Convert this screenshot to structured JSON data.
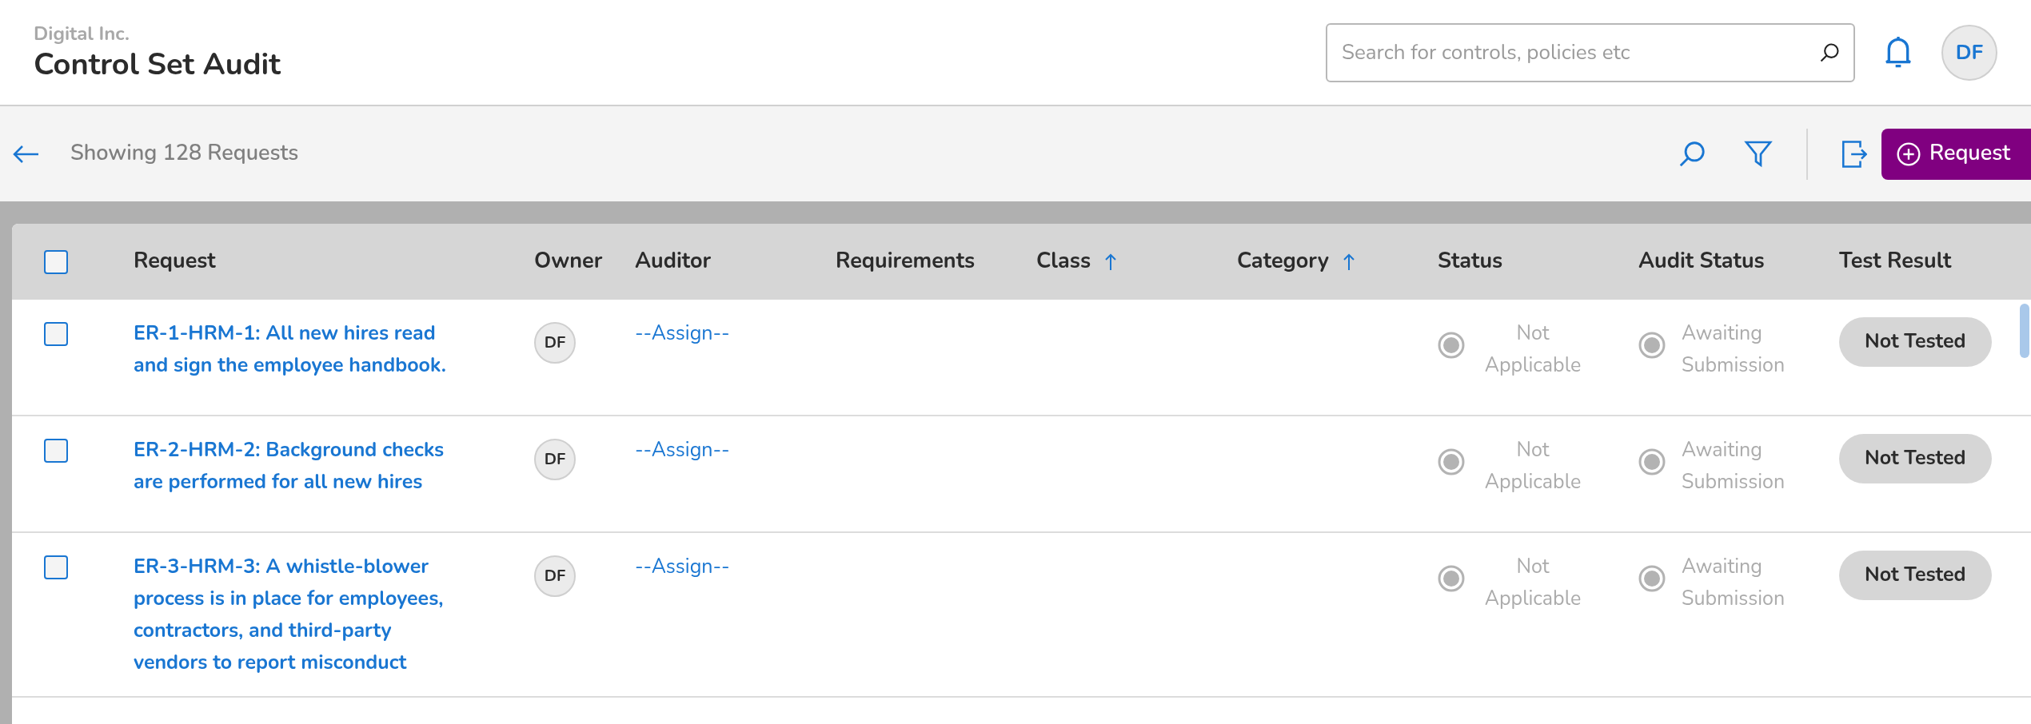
{
  "header": {
    "company": "Digital Inc.",
    "title": "Control Set Audit",
    "search": {
      "placeholder": "Search for controls, policies etc"
    },
    "avatar": "DF"
  },
  "toolbar": {
    "summary": "Showing 128 Requests",
    "add_button": "Request"
  },
  "table": {
    "select_all": {
      "checked": false
    },
    "columns": [
      {
        "label": "Request",
        "sorted": false
      },
      {
        "label": "Owner",
        "sorted": false
      },
      {
        "label": "Auditor",
        "sorted": false
      },
      {
        "label": "Requirements",
        "sorted": false
      },
      {
        "label": "Class",
        "sorted": true
      },
      {
        "label": "Category",
        "sorted": true
      },
      {
        "label": "Status",
        "sorted": false
      },
      {
        "label": "Audit Status",
        "sorted": false
      },
      {
        "label": "Test Result",
        "sorted": false
      }
    ],
    "rows": [
      {
        "checked": false,
        "request": "ER-1-HRM-1: All new hires read and sign the employee handbook.",
        "owner": "DF",
        "auditor": "--Assign--",
        "status": "Not Applicable",
        "audit_status": "Awaiting Submission",
        "test_result": "Not Tested"
      },
      {
        "checked": false,
        "request": "ER-2-HRM-2: Background checks are performed for all new hires",
        "owner": "DF",
        "auditor": "--Assign--",
        "status": "Not Applicable",
        "audit_status": "Awaiting Submission",
        "test_result": "Not Tested"
      },
      {
        "checked": false,
        "request": "ER-3-HRM-3: A whistle-blower process is in place for employees, contractors, and third-party vendors to report misconduct",
        "owner": "DF",
        "auditor": "--Assign--",
        "status": "Not Applicable",
        "audit_status": "Awaiting Submission",
        "test_result": "Not Tested"
      }
    ]
  }
}
